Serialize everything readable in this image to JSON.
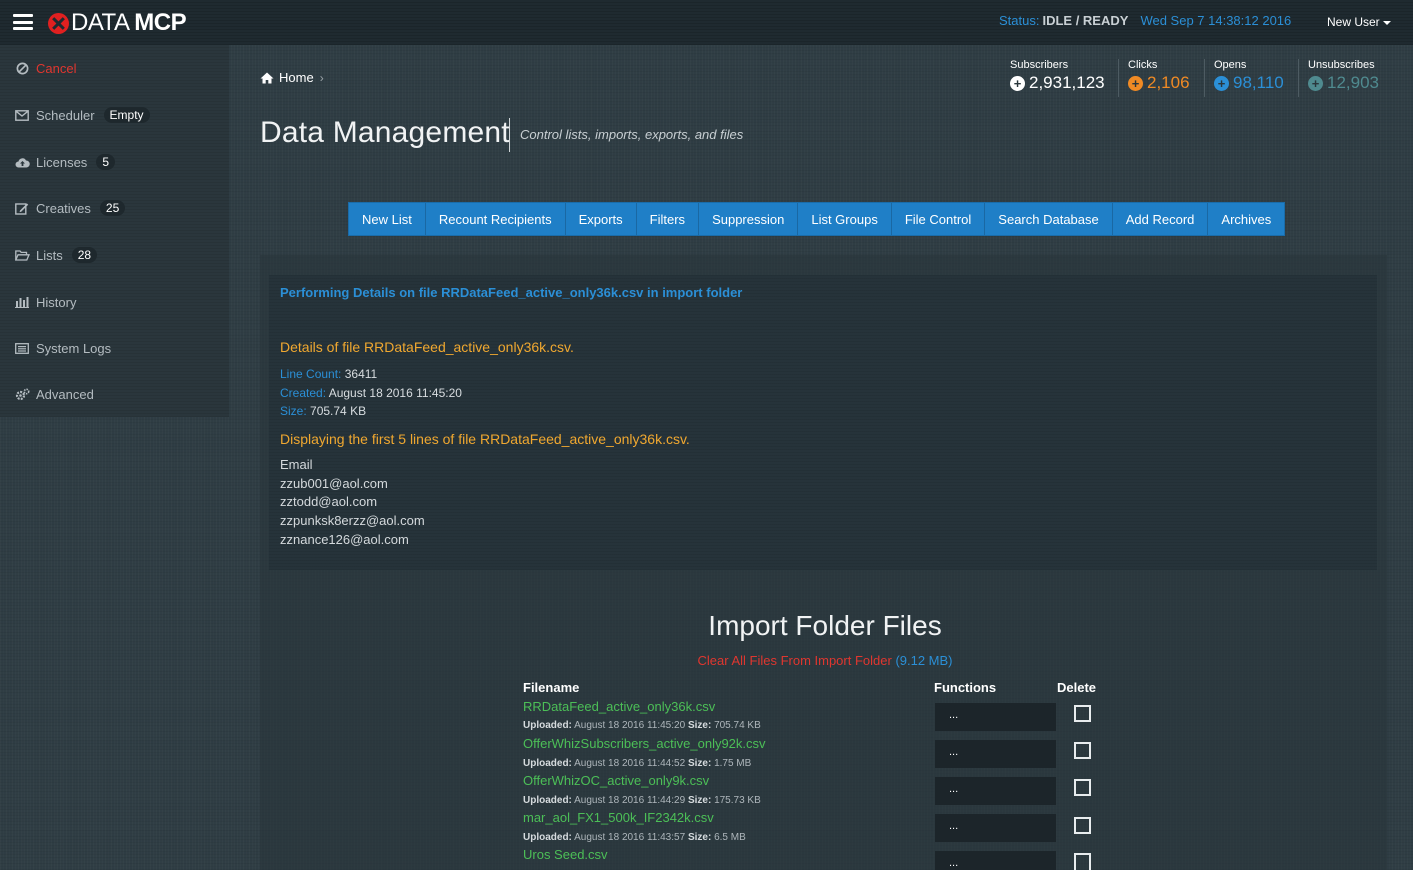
{
  "app": {
    "logo_text_1": "DATA",
    "logo_text_2": "MCP"
  },
  "status": {
    "label": "Status:",
    "value": "IDLE / READY",
    "datetime": "Wed Sep 7 14:38:12 2016",
    "user": "New User"
  },
  "sidebar": {
    "items": [
      {
        "label": "Cancel",
        "icon": "ban-icon"
      },
      {
        "label": "Scheduler",
        "icon": "envelope-icon",
        "badge": "Empty"
      },
      {
        "label": "Licenses",
        "icon": "cloud-upload-icon",
        "badge": "5"
      },
      {
        "label": "Creatives",
        "icon": "edit-icon",
        "badge": "25"
      },
      {
        "label": "Lists",
        "icon": "folder-open-icon",
        "badge": "28"
      },
      {
        "label": "History",
        "icon": "bar-chart-icon"
      },
      {
        "label": "System Logs",
        "icon": "list-icon"
      },
      {
        "label": "Advanced",
        "icon": "cogs-icon"
      }
    ]
  },
  "breadcrumb": {
    "home": "Home"
  },
  "page": {
    "title": "Data Management",
    "subtitle": "Control lists, imports, exports, and files"
  },
  "stats": [
    {
      "label": "Subscribers",
      "value": "2,931,123",
      "color": "#ffffff"
    },
    {
      "label": "Clicks",
      "value": "2,106",
      "color": "#f08a24"
    },
    {
      "label": "Opens",
      "value": "98,110",
      "color": "#2b8fd6"
    },
    {
      "label": "Unsubscribes",
      "value": "12,903",
      "color": "#4f8a8f"
    }
  ],
  "tabs": [
    "New List",
    "Recount Recipients",
    "Exports",
    "Filters",
    "Suppression",
    "List Groups",
    "File Control",
    "Search Database",
    "Add Record",
    "Archives"
  ],
  "details": {
    "performing": "Performing Details on file RRDataFeed_active_only36k.csv in import folder",
    "heading": "Details of file RRDataFeed_active_only36k.csv.",
    "line_count_label": "Line Count:",
    "line_count": "36411",
    "created_label": "Created:",
    "created": "August 18 2016 11:45:20",
    "size_label": "Size:",
    "size": "705.74 KB",
    "display_heading": "Displaying the first 5 lines of file RRDataFeed_active_only36k.csv.",
    "lines": [
      "Email",
      "zzub001@aol.com",
      "zztodd@aol.com",
      "zzpunksk8erzz@aol.com",
      "zznance126@aol.com"
    ]
  },
  "import_folder": {
    "title": "Import Folder Files",
    "clear_label": "Clear All Files From Import Folder",
    "total_size": "(9.12 MB)",
    "headers": {
      "filename": "Filename",
      "functions": "Functions",
      "delete": "Delete"
    },
    "uploaded_label": "Uploaded:",
    "size_label": "Size:",
    "function_placeholder": "...",
    "files": [
      {
        "name": "RRDataFeed_active_only36k.csv",
        "uploaded": "August 18 2016 11:45:20",
        "size": "705.74 KB"
      },
      {
        "name": "OfferWhizSubscribers_active_only92k.csv",
        "uploaded": "August 18 2016 11:44:52",
        "size": "1.75 MB"
      },
      {
        "name": "OfferWhizOC_active_only9k.csv",
        "uploaded": "August 18 2016 11:44:29",
        "size": "175.73 KB"
      },
      {
        "name": "mar_aol_FX1_500k_IF2342k.csv",
        "uploaded": "August 18 2016 11:43:57",
        "size": "6.5 MB"
      },
      {
        "name": "Uros Seed.csv"
      }
    ]
  }
}
